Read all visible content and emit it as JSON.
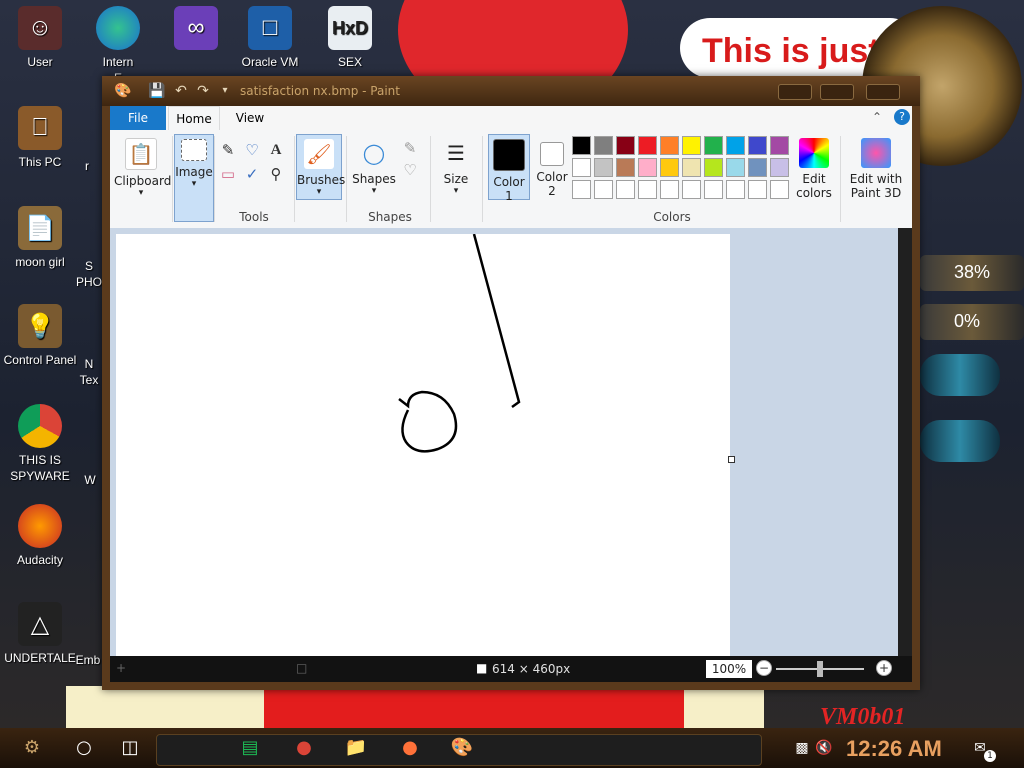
{
  "desktop": {
    "banner_text": "This is just",
    "gauges": [
      "38%",
      "0%"
    ],
    "corner_text": "VM0b01",
    "icons": [
      {
        "label": "User",
        "icon": "user-icon"
      },
      {
        "label": "Intern",
        "label2": "E",
        "icon": "edge-icon"
      },
      {
        "label": "",
        "icon": "visual-studio-icon"
      },
      {
        "label": "Oracle VM",
        "icon": "virtualbox-icon"
      },
      {
        "label": "SEX",
        "icon": "hxd-icon"
      },
      {
        "label": "This PC",
        "icon": "computer-icon"
      },
      {
        "label": "moon girl",
        "icon": "document-icon"
      },
      {
        "label": "Control Panel",
        "icon": "control-panel-icon"
      },
      {
        "label": "THIS IS",
        "label2": "SPYWARE",
        "icon": "chrome-icon"
      },
      {
        "label": "Audacity",
        "icon": "audacity-icon"
      },
      {
        "label": "UNDERTALE",
        "icon": "unity-icon"
      },
      {
        "label": "r",
        "icon": "partial-icon"
      },
      {
        "label": "S",
        "label2": "PHO",
        "icon": "partial-icon"
      },
      {
        "label": "N",
        "label2": "Tex",
        "icon": "partial-icon"
      },
      {
        "label": "W",
        "icon": "partial-icon"
      },
      {
        "label": "Emb",
        "icon": "partial-icon"
      }
    ]
  },
  "window": {
    "title": "satisfaction nx.bmp - Paint",
    "tabs": [
      "File",
      "Home",
      "View"
    ],
    "ribbon": {
      "clipboard": "Clipboard",
      "image": "Image",
      "tools": "Tools",
      "brushes": "Brushes",
      "shapes_btn": "Shapes",
      "shapes_group": "Shapes",
      "size": "Size",
      "color1": "Color\n1",
      "color1_a": "Color",
      "color1_b": "1",
      "color2_a": "Color",
      "color2_b": "2",
      "colors_group": "Colors",
      "edit_colors_a": "Edit",
      "edit_colors_b": "colors",
      "paint3d_a": "Edit with",
      "paint3d_b": "Paint 3D"
    },
    "palette_row1": [
      "#000000",
      "#7f7f7f",
      "#880015",
      "#ed1c24",
      "#ff7f27",
      "#fff200",
      "#22b14c",
      "#00a2e8",
      "#3f48cc",
      "#a349a4"
    ],
    "palette_row2": [
      "#ffffff",
      "#c3c3c3",
      "#b97a57",
      "#ffaec9",
      "#ffc90e",
      "#efe4b0",
      "#b5e61d",
      "#99d9ea",
      "#7092be",
      "#c8bfe7"
    ],
    "color1_value": "#000000",
    "color2_value": "#ffffff",
    "status": {
      "dimensions": "614 × 460px",
      "zoom": "100%"
    }
  },
  "taskbar": {
    "time": "12:26 AM",
    "apps": [
      "start-icon",
      "cortana-icon",
      "task-view-icon",
      "spotify-icon",
      "chrome-icon",
      "file-explorer-icon",
      "firefox-icon",
      "paint-icon"
    ],
    "notification_count": "1"
  }
}
